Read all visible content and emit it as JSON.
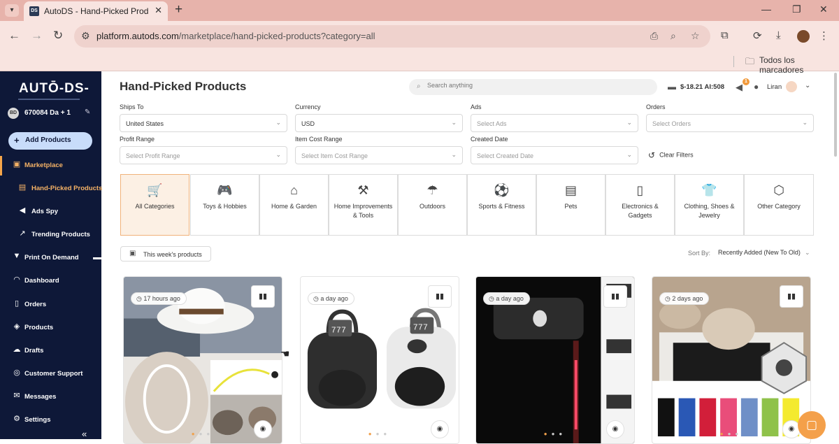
{
  "browser": {
    "tab_title": "AutoDS - Hand-Picked Product",
    "tab_favicon": "DS",
    "url_host": "platform.autods.com",
    "url_path": "/marketplace/hand-picked-products?category=all",
    "bookmarks_label": "Todos los marcadores"
  },
  "sidebar": {
    "logo": "AUTŌ-DS-",
    "account_initials": "BD",
    "account_name": "670084 Da + 1",
    "add_products": "Add Products",
    "items": [
      {
        "label": "Marketplace",
        "icon": "store-icon"
      },
      {
        "label": "Hand-Picked Products",
        "icon": "hand-picked-icon"
      },
      {
        "label": "Ads Spy",
        "icon": "megaphone-icon"
      },
      {
        "label": "Trending Products",
        "icon": "trending-icon"
      },
      {
        "label": "Print On Demand",
        "icon": "shirt-icon"
      },
      {
        "label": "Dashboard",
        "icon": "dashboard-icon"
      },
      {
        "label": "Orders",
        "icon": "orders-icon"
      },
      {
        "label": "Products",
        "icon": "box-icon"
      },
      {
        "label": "Drafts",
        "icon": "drafts-icon"
      },
      {
        "label": "Customer Support",
        "icon": "headset-icon"
      },
      {
        "label": "Messages",
        "icon": "mail-icon"
      },
      {
        "label": "Settings",
        "icon": "gear-icon"
      }
    ]
  },
  "header": {
    "title": "Hand-Picked Products",
    "search_placeholder": "Search anything",
    "wallet": "$-18.21  AI:508",
    "notifications": "1",
    "user": "Liran"
  },
  "filters": {
    "ships_to": {
      "label": "Ships To",
      "value": "United States"
    },
    "currency": {
      "label": "Currency",
      "value": "USD"
    },
    "ads": {
      "label": "Ads",
      "value": "Select Ads"
    },
    "orders": {
      "label": "Orders",
      "value": "Select Orders"
    },
    "profit_range": {
      "label": "Profit Range",
      "value": "Select Profit Range"
    },
    "item_cost_range": {
      "label": "Item Cost Range",
      "value": "Select Item Cost Range"
    },
    "created_date": {
      "label": "Created Date",
      "value": "Select Created Date"
    },
    "clear": "Clear Filters"
  },
  "categories": [
    {
      "label": "All Categories",
      "icon": "cart-icon",
      "selected": true
    },
    {
      "label": "Toys & Hobbies",
      "icon": "gamepad-icon"
    },
    {
      "label": "Home & Garden",
      "icon": "house-icon"
    },
    {
      "label": "Home Improvements & Tools",
      "icon": "tools-icon"
    },
    {
      "label": "Outdoors",
      "icon": "umbrella-icon"
    },
    {
      "label": "Sports & Fitness",
      "icon": "ball-icon"
    },
    {
      "label": "Pets",
      "icon": "pet-food-icon"
    },
    {
      "label": "Electronics & Gadgets",
      "icon": "phone-icon"
    },
    {
      "label": "Clothing, Shoes & Jewelry",
      "icon": "shirt-icon"
    },
    {
      "label": "Other Category",
      "icon": "cube-icon"
    }
  ],
  "listing": {
    "week_button": "This week's products",
    "sort_label": "Sort By:",
    "sort_value": "Recently Added (New To Old)"
  },
  "products": [
    {
      "time": "17 hours ago"
    },
    {
      "time": "a day ago"
    },
    {
      "time": "a day ago"
    },
    {
      "time": "2 days ago"
    }
  ],
  "colors": {
    "sidebar_bg": "#0e1838",
    "accent": "#f4a04a",
    "active_nav": "#f5b266"
  }
}
